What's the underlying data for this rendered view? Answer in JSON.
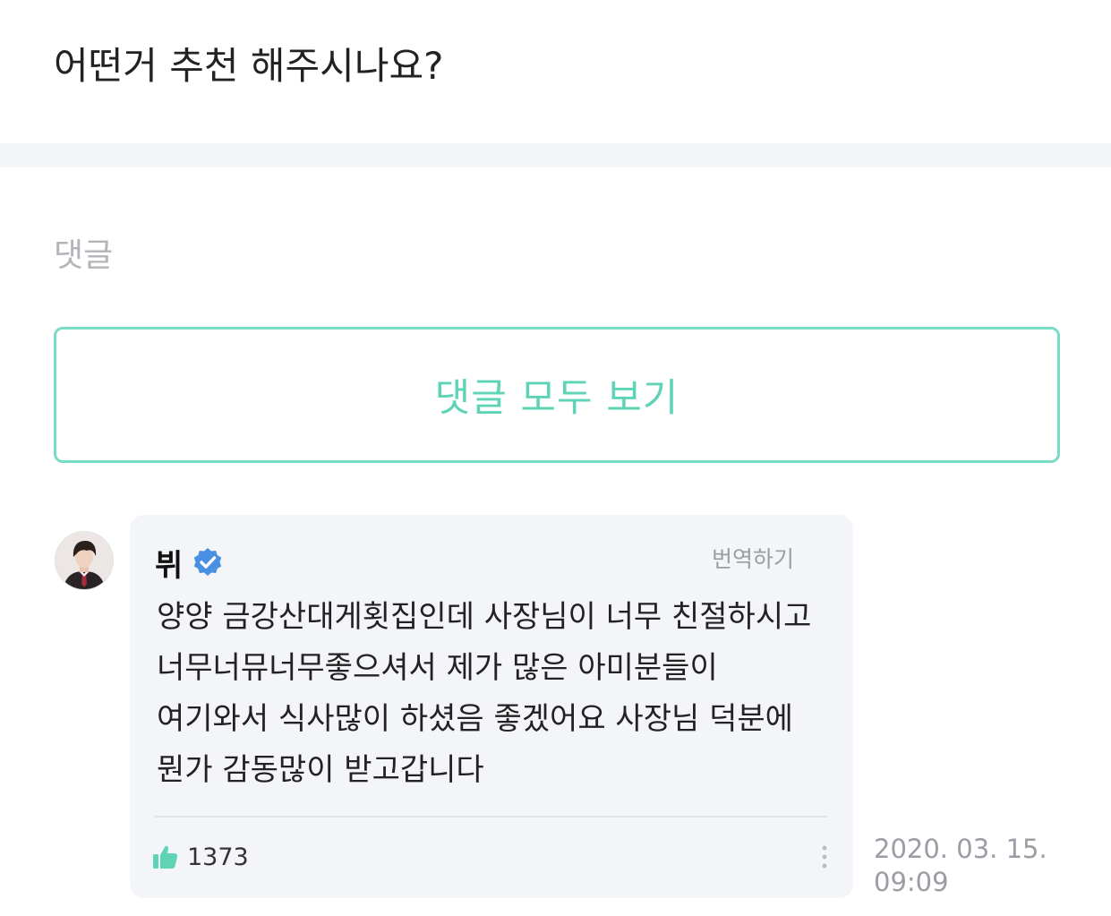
{
  "post": {
    "title": "어떤거 추천 해주시나요?"
  },
  "comments_section": {
    "heading": "댓글",
    "view_all_label": "댓글 모두 보기"
  },
  "comment": {
    "author": "뷔",
    "verified_icon": "verified-badge-icon",
    "translate_label": "번역하기",
    "body": "양양 금강산대게횟집인데 사장님이 너무 친절하시고 너무너뮤너무좋으셔서 제가 많은 아미분들이 여기와서 식사많이 하셨음 좋겠어요 사장님 덕분에 뭔가 감동많이 받고갑니다",
    "like_icon": "thumbs-up-icon",
    "like_count": "1373",
    "more_icon": "vertical-ellipsis-icon",
    "date": "2020. 03. 15.",
    "time": "09:09"
  },
  "colors": {
    "accent": "#5fd3b6",
    "verified": "#4a90e2",
    "card_background": "#f4f5f8",
    "muted_text": "#9a9da3"
  }
}
